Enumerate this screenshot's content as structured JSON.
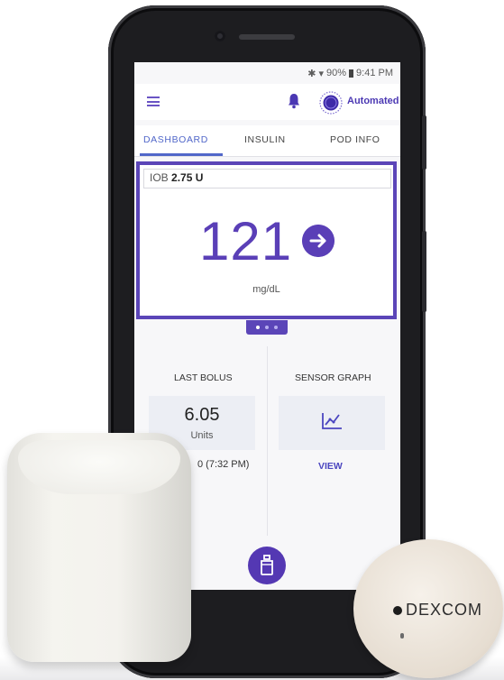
{
  "status_bar": {
    "battery": "90%",
    "time": "9:41 PM"
  },
  "header": {
    "mode_label": "Automated"
  },
  "tabs": [
    {
      "label": "DASHBOARD",
      "active": true
    },
    {
      "label": "INSULIN",
      "active": false
    },
    {
      "label": "POD INFO",
      "active": false
    }
  ],
  "glucose": {
    "iob_label": "IOB",
    "iob_value": "2.75 U",
    "value": "121",
    "unit": "mg/dL",
    "trend": "steady-arrow-right"
  },
  "pager": {
    "pages": 3,
    "current": 1
  },
  "last_bolus": {
    "title": "LAST BOLUS",
    "value": "6.05",
    "unit": "Units",
    "time": "0 (7:32 PM)"
  },
  "sensor_graph": {
    "title": "SENSOR GRAPH",
    "link_label": "VIEW"
  },
  "sensor_device": {
    "brand": "DEXCOM"
  },
  "colors": {
    "accent": "#5a3fb7",
    "tab_active": "#5167c9",
    "phone_body": "#1d1d20"
  }
}
